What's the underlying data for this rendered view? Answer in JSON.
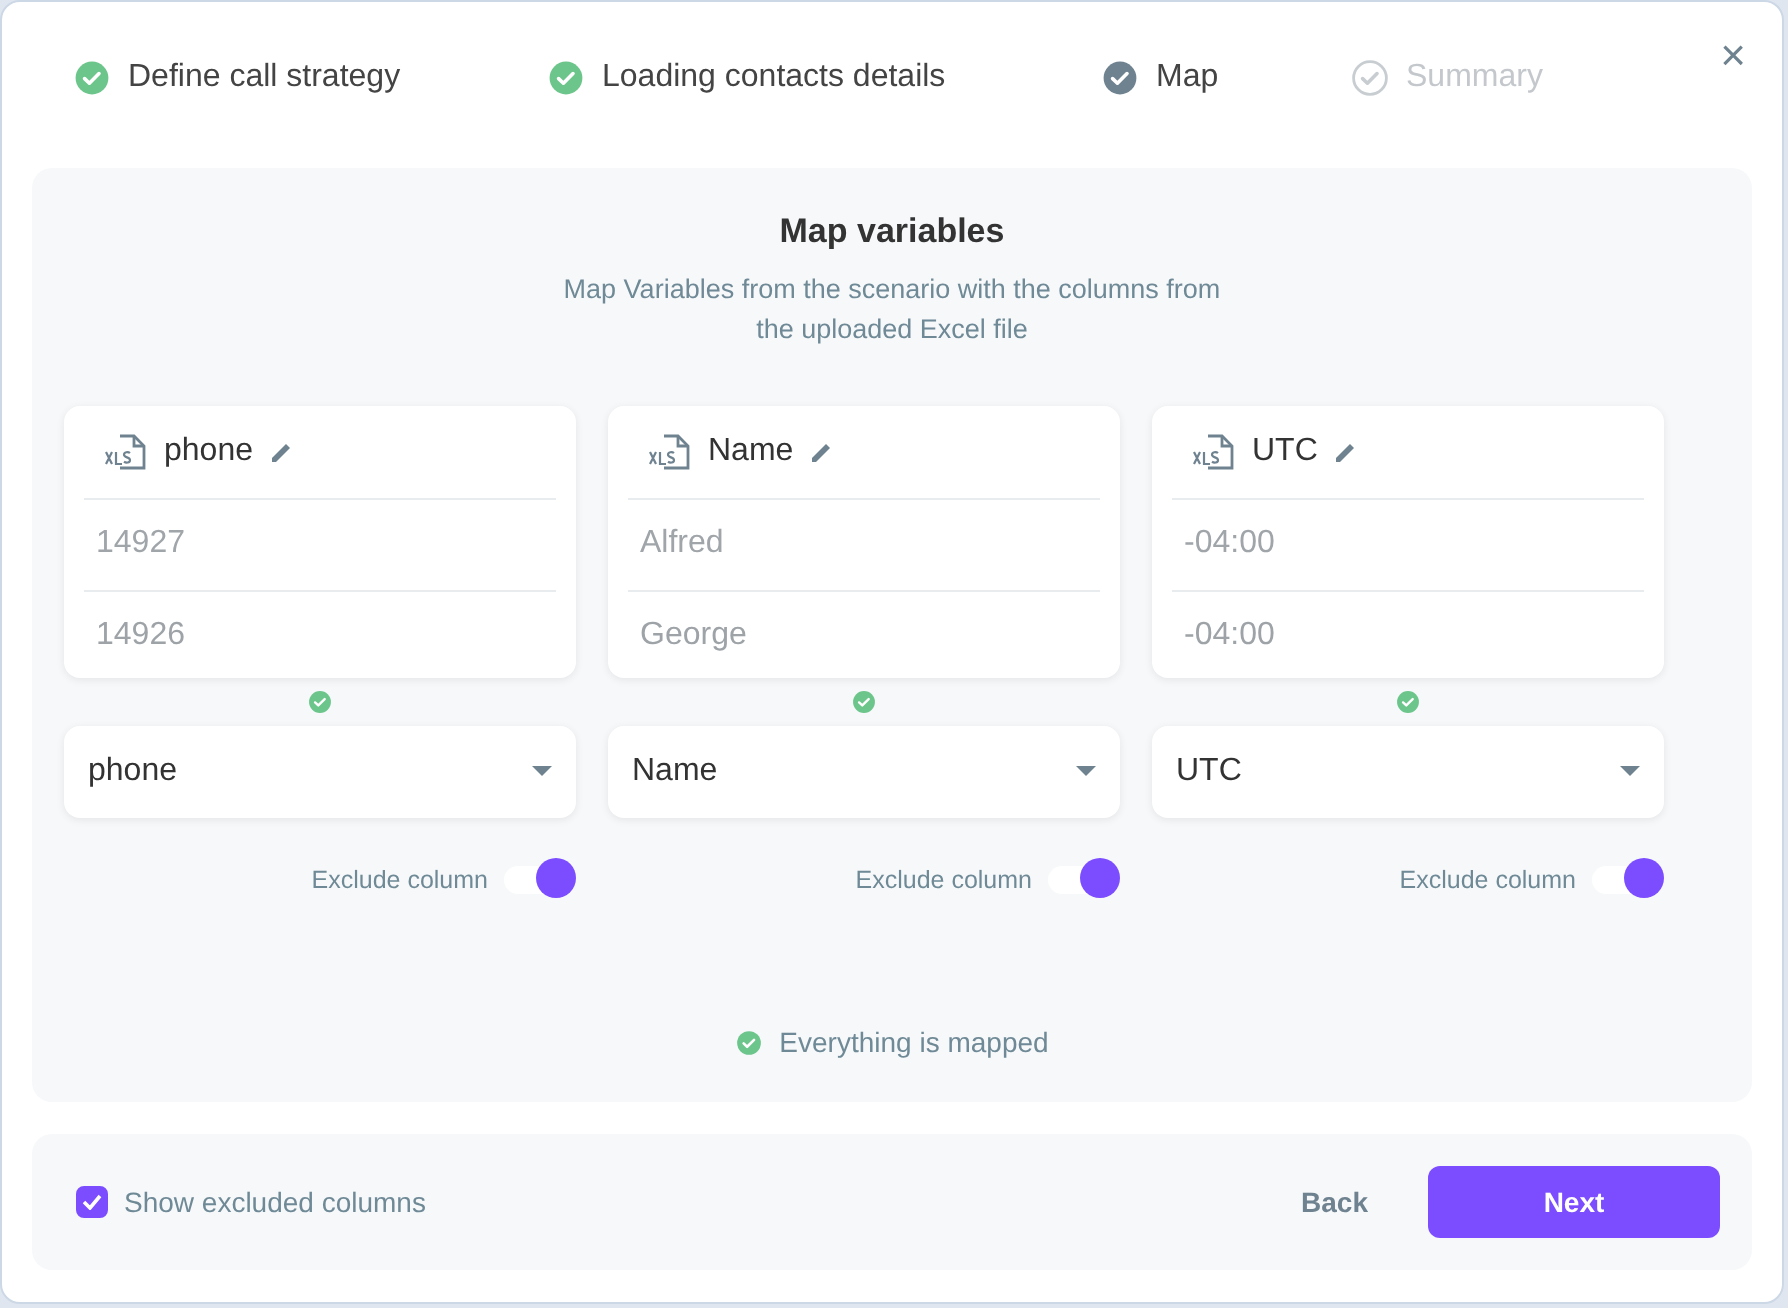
{
  "steps": [
    {
      "label": "Define call strategy",
      "kind": "done"
    },
    {
      "label": "Loading contacts details",
      "kind": "done"
    },
    {
      "label": "Map",
      "kind": "current"
    },
    {
      "label": "Summary",
      "kind": "pending"
    }
  ],
  "close": "×",
  "title": "Map variables",
  "subtitle": [
    "Map Variables from the scenario with the columns from",
    "the uploaded Excel file"
  ],
  "columns": [
    {
      "name": "phone",
      "rows": [
        "14927",
        "14926"
      ],
      "mapped": true,
      "select": "phone",
      "exclude_label": "Exclude column",
      "exclude": true
    },
    {
      "name": "Name",
      "rows": [
        "Alfred",
        "George"
      ],
      "mapped": true,
      "select": "Name",
      "exclude_label": "Exclude column",
      "exclude": true
    },
    {
      "name": "UTC",
      "rows": [
        "-04:00",
        "-04:00"
      ],
      "mapped": true,
      "select": "UTC",
      "exclude_label": "Exclude column",
      "exclude": true
    }
  ],
  "status": {
    "text": "Everything is mapped",
    "ok": true
  },
  "footer": {
    "checkbox": {
      "label": "Show excluded columns",
      "checked": true
    },
    "buttons": [
      "Back",
      "Next"
    ]
  }
}
